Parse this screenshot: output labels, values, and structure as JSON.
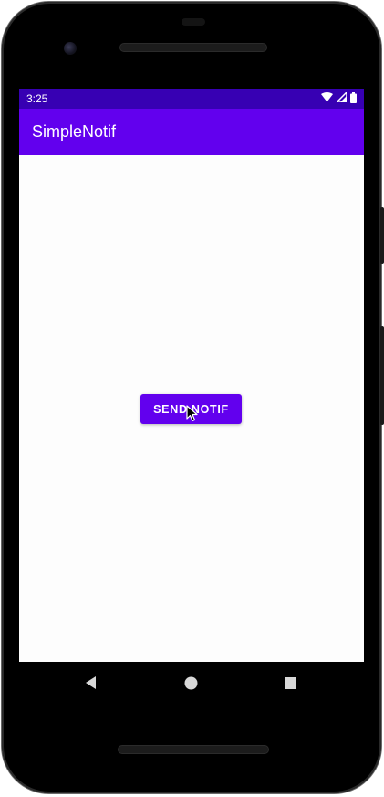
{
  "status_bar": {
    "time": "3:25",
    "icons": [
      "wifi-icon",
      "cell-signal-icon",
      "battery-icon"
    ]
  },
  "app_bar": {
    "title": "SimpleNotif"
  },
  "main": {
    "send_button_label": "SEND NOTIF"
  },
  "nav_bar": {
    "buttons": [
      "back-icon",
      "home-icon",
      "recents-icon"
    ]
  },
  "colors": {
    "status_bar": "#3700b3",
    "app_bar": "#6200ee",
    "button": "#6200ee",
    "background": "#fdfdfd"
  }
}
